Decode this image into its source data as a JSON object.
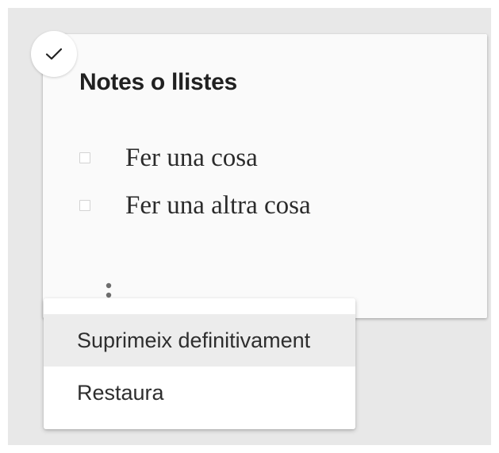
{
  "note": {
    "title": "Notes o llistes",
    "selected": true,
    "items": [
      {
        "label": "Fer una cosa",
        "checked": false
      },
      {
        "label": "Fer una altra cosa",
        "checked": false
      }
    ]
  },
  "menu": {
    "items": [
      {
        "label": "Suprimeix definitivament",
        "highlighted": true
      },
      {
        "label": "Restaura",
        "highlighted": false
      }
    ]
  },
  "icons": {
    "select": "check-icon",
    "more": "more-vertical-icon"
  },
  "colors": {
    "background": "#e8e8e8",
    "card": "#fafafa",
    "menu_highlight": "#ececec"
  }
}
